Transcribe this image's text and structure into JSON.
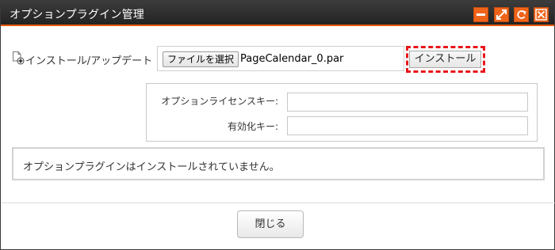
{
  "dialog": {
    "title": "オプションプラグイン管理",
    "title_buttons": [
      {
        "icon": "minimize-icon"
      },
      {
        "icon": "maximize-icon"
      },
      {
        "icon": "refresh-icon"
      },
      {
        "icon": "close-icon"
      }
    ],
    "accent_color": "#f0641a"
  },
  "install": {
    "label": "インストール/アップデート",
    "file_button_label": "ファイルを選択",
    "file_name": "PageCalendar_0.par",
    "install_button_label": "インストール",
    "highlight_color": "#e8161b"
  },
  "license": {
    "license_key_label": "オプションライセンスキー:",
    "license_key_value": "",
    "activation_key_label": "有効化キー:",
    "activation_key_value": ""
  },
  "status": {
    "message": "オプションプラグインはインストールされていません。"
  },
  "footer": {
    "close_label": "閉じる"
  }
}
